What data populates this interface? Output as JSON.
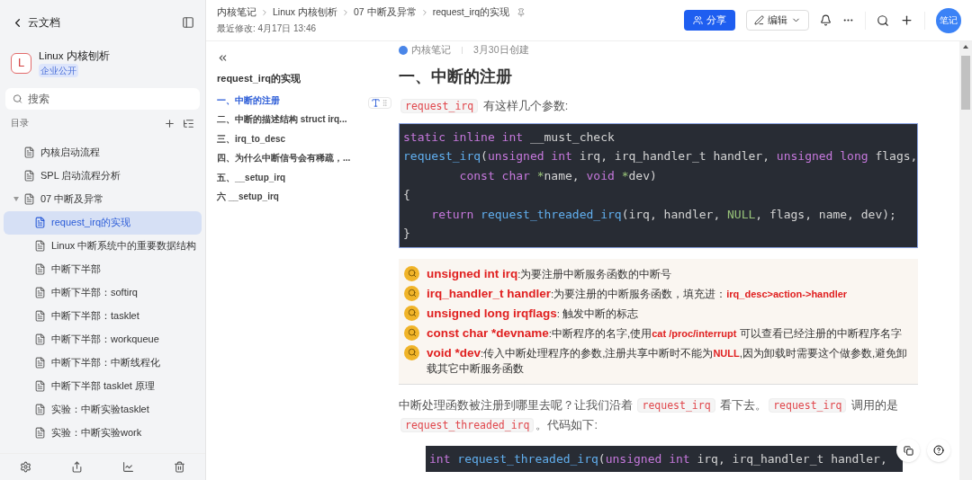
{
  "sidebar": {
    "back_label": "云文档",
    "space": {
      "letter": "L",
      "title": "Linux 内核刨析",
      "badge": "企业公开"
    },
    "search": {
      "placeholder": "搜索"
    },
    "section_label": "目录",
    "items": [
      {
        "label": "内核启动流程",
        "selected": false
      },
      {
        "label": "SPL 启动流程分析",
        "selected": false
      },
      {
        "label": "07 中断及异常",
        "selected": false,
        "expanded": true,
        "children": [
          {
            "label": "request_irq的实现",
            "selected": true
          },
          {
            "label": "Linux 中断系统中的重要数据结构",
            "selected": false
          },
          {
            "label": "中断下半部",
            "selected": false
          },
          {
            "label": "中断下半部：softirq",
            "selected": false
          },
          {
            "label": "中断下半部：tasklet",
            "selected": false
          },
          {
            "label": "中断下半部：workqueue",
            "selected": false
          },
          {
            "label": "中断下半部：中断线程化",
            "selected": false
          },
          {
            "label": "中断下半部 tasklet 原理",
            "selected": false
          },
          {
            "label": "实验：中断实验tasklet",
            "selected": false
          },
          {
            "label": "实验：中断实验work",
            "selected": false
          }
        ]
      }
    ]
  },
  "header": {
    "breadcrumbs": [
      "内核笔记",
      "Linux 内核刨析",
      "07 中断及异常",
      "request_irq的实现"
    ],
    "modified": "最近修改: 4月17日 13:46",
    "share_button": "分享",
    "edit_button": "编辑",
    "avatar": "笔记"
  },
  "outline": {
    "title": "request_irq的实现",
    "items": [
      {
        "label": "一、中断的注册",
        "selected": true
      },
      {
        "label": "二、中断的描述结构 struct irq...",
        "selected": false
      },
      {
        "label": "三、irq_to_desc",
        "selected": false
      },
      {
        "label": "四、为什么中断信号会有稀疏，...",
        "selected": false
      },
      {
        "label": "五、__setup_irq",
        "selected": false
      },
      {
        "label": "六 __setup_irq",
        "selected": false
      }
    ]
  },
  "document": {
    "author": "内核笔记",
    "created": "3月30日创建",
    "heading": "一、中断的注册",
    "intro": [
      {
        "kind": "code",
        "text": "request_irq"
      },
      {
        "kind": "text",
        "text": " 有这样几个参数:"
      }
    ],
    "code_block": [
      [
        {
          "kind": "keyword",
          "text": "static inline int "
        },
        {
          "kind": "plain",
          "text": "__must_check"
        }
      ],
      [
        {
          "kind": "func",
          "text": "request_irq"
        },
        {
          "kind": "plain",
          "text": "("
        },
        {
          "kind": "keyword",
          "text": "unsigned int "
        },
        {
          "kind": "plain",
          "text": "irq, irq_handler_t handler, "
        },
        {
          "kind": "keyword",
          "text": "unsigned long "
        },
        {
          "kind": "plain",
          "text": "flags,"
        }
      ],
      [
        {
          "kind": "keyword",
          "text": "        const char "
        },
        {
          "kind": "null",
          "text": "*"
        },
        {
          "kind": "plain",
          "text": "name, "
        },
        {
          "kind": "keyword",
          "text": "void "
        },
        {
          "kind": "null",
          "text": "*"
        },
        {
          "kind": "plain",
          "text": "dev)"
        }
      ],
      [
        {
          "kind": "plain",
          "text": "{"
        }
      ],
      [
        {
          "kind": "keyword",
          "text": "    return "
        },
        {
          "kind": "func",
          "text": "request_threaded_irq"
        },
        {
          "kind": "plain",
          "text": "(irq, handler, "
        },
        {
          "kind": "null",
          "text": "NULL"
        },
        {
          "kind": "plain",
          "text": ", flags, name, dev);"
        }
      ],
      [
        {
          "kind": "plain",
          "text": "}"
        }
      ]
    ],
    "params": [
      [
        {
          "kind": "red",
          "text": "unsigned int irq"
        },
        {
          "kind": "plain",
          "text": ":为要注册中断服务函数的中断号"
        }
      ],
      [
        {
          "kind": "red",
          "text": "irq_handler_t handler"
        },
        {
          "kind": "plain",
          "text": ":为要注册的中断服务函数，填充进："
        },
        {
          "kind": "red_small",
          "text": "irq_desc>action->handler"
        }
      ],
      [
        {
          "kind": "red",
          "text": "unsigned long irqflags"
        },
        {
          "kind": "plain",
          "text": ": 触发中断的标志"
        }
      ],
      [
        {
          "kind": "red",
          "text": "const char *devname"
        },
        {
          "kind": "plain",
          "text": ":中断程序的名字,使用"
        },
        {
          "kind": "red_small",
          "text": "cat /proc/interrupt"
        },
        {
          "kind": "plain",
          "text": " 可以查看已经注册的中断程序名字"
        }
      ],
      [
        {
          "kind": "red",
          "text": "void *dev"
        },
        {
          "kind": "plain",
          "text": ":传入中断处理程序的参数,注册共享中断时不能为"
        },
        {
          "kind": "red_small",
          "text": "NULL"
        },
        {
          "kind": "plain",
          "text": ",因为卸载时需要这个做参数,避免卸载其它中断服务函数"
        }
      ]
    ],
    "paragraph": [
      {
        "kind": "text",
        "text": "中断处理函数被注册到哪里去呢？让我们沿着 "
      },
      {
        "kind": "code",
        "text": "request_irq"
      },
      {
        "kind": "text",
        "text": " 看下去。"
      },
      {
        "kind": "code",
        "text": "request_irq"
      },
      {
        "kind": "text",
        "text": " 调用的是 "
      },
      {
        "kind": "code",
        "text": "request_threaded_irq"
      },
      {
        "kind": "text",
        "text": "。代码如下:"
      }
    ],
    "code_block_2": [
      [
        {
          "kind": "keyword",
          "text": "int "
        },
        {
          "kind": "func",
          "text": "request_threaded_irq"
        },
        {
          "kind": "plain",
          "text": "("
        },
        {
          "kind": "keyword",
          "text": "unsigned int "
        },
        {
          "kind": "plain",
          "text": "irq, irq_handler_t handler,"
        }
      ]
    ]
  }
}
